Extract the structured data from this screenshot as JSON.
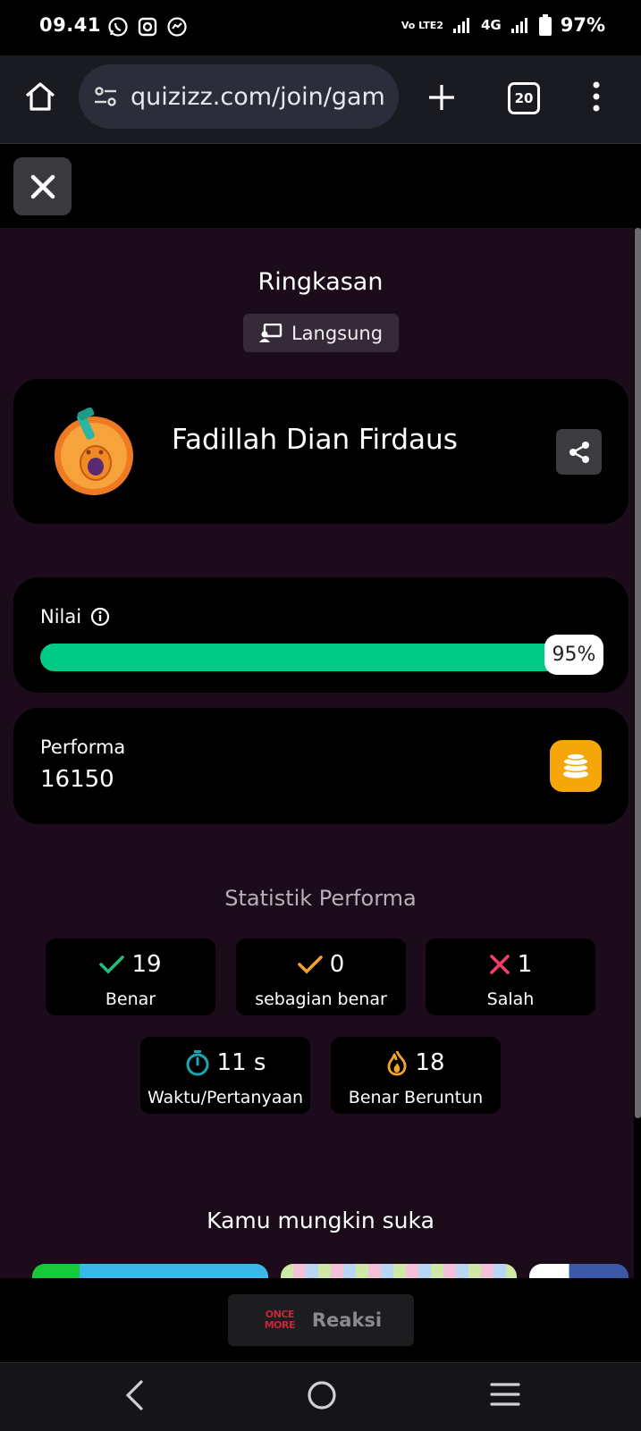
{
  "status_bar": {
    "time": "09.41",
    "battery": "97%",
    "network": "4G",
    "volte": "Vo LTE2"
  },
  "browser": {
    "url": "quizizz.com/join/gam",
    "tab_count": "20"
  },
  "summary": {
    "title": "Ringkasan",
    "mode_label": "Langsung"
  },
  "player": {
    "name": "Fadillah Dian Firdaus"
  },
  "score": {
    "label": "Nilai",
    "percent": 95,
    "percent_label": "95%",
    "bar_color": "#00c985"
  },
  "performance": {
    "label": "Performa",
    "value": "16150"
  },
  "stats": {
    "title": "Statistik Performa",
    "correct": {
      "value": "19",
      "label": "Benar"
    },
    "partial": {
      "value": "0",
      "label": "sebagian benar"
    },
    "wrong": {
      "value": "1",
      "label": "Salah"
    },
    "time_per_question": {
      "value": "11 s",
      "label": "Waktu/Pertanyaan"
    },
    "streak": {
      "value": "18",
      "label": "Benar Beruntun"
    }
  },
  "recommend": {
    "title": "Kamu mungkin suka"
  },
  "footer": {
    "reaction_logo": "ONCE MORE",
    "reaction_label": "Reaksi"
  },
  "colors": {
    "correct": "#1fbf78",
    "partial": "#f3a52a",
    "wrong": "#f0406a",
    "timer": "#1aa7b4",
    "streak": "#f3a52a",
    "coin": "#f5a70a"
  }
}
